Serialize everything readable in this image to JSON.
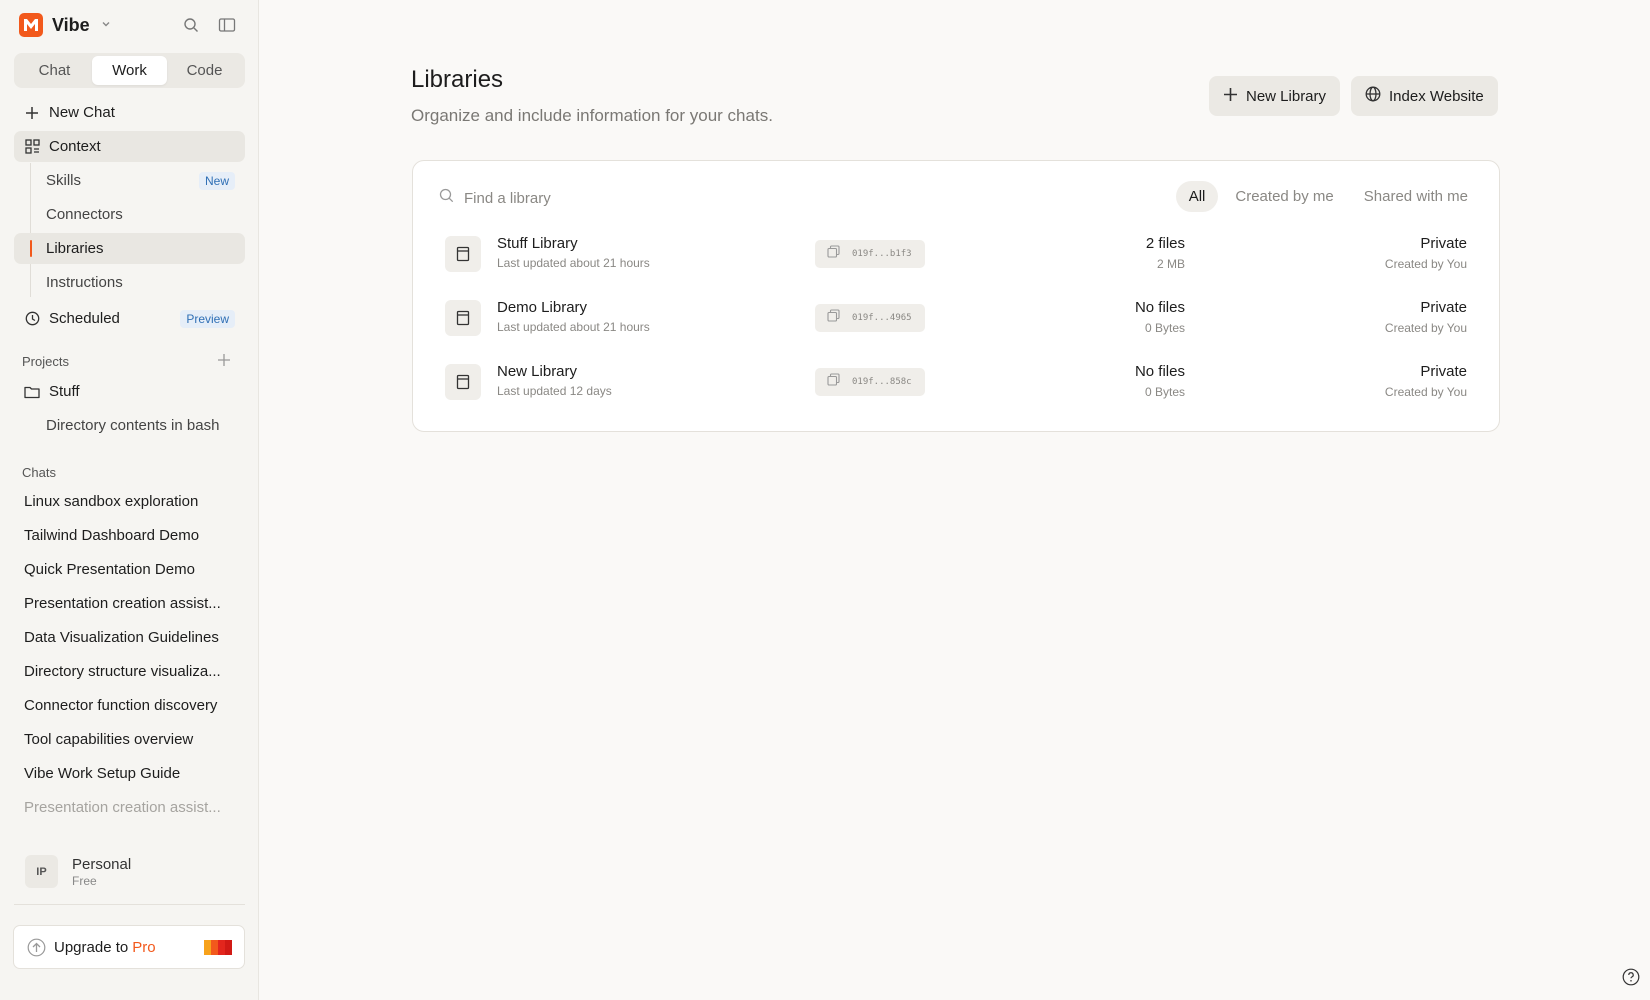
{
  "app": {
    "name": "Vibe"
  },
  "mode_tabs": [
    {
      "label": "Chat",
      "active": false
    },
    {
      "label": "Work",
      "active": true
    },
    {
      "label": "Code",
      "active": false
    }
  ],
  "nav": {
    "new_chat": "New Chat",
    "context": "Context",
    "context_items": [
      {
        "label": "Skills",
        "badge": "New"
      },
      {
        "label": "Connectors",
        "badge": ""
      },
      {
        "label": "Libraries",
        "badge": ""
      },
      {
        "label": "Instructions",
        "badge": ""
      }
    ],
    "scheduled": "Scheduled",
    "scheduled_badge": "Preview"
  },
  "projects": {
    "label": "Projects",
    "items": [
      {
        "name": "Stuff",
        "children": [
          "Directory contents in bash"
        ]
      }
    ]
  },
  "chats": {
    "label": "Chats",
    "items": [
      "Linux sandbox exploration",
      "Tailwind Dashboard Demo",
      "Quick Presentation Demo",
      "Presentation creation assist...",
      "Data Visualization Guidelines",
      "Directory structure visualiza...",
      "Connector function discovery",
      "Tool capabilities overview",
      "Vibe Work Setup Guide",
      "Presentation creation assist..."
    ]
  },
  "account": {
    "initials": "IP",
    "name": "Personal",
    "plan": "Free"
  },
  "upgrade": {
    "prefix": "Upgrade to",
    "highlight": "Pro"
  },
  "page": {
    "title": "Libraries",
    "subtitle": "Organize and include information for your chats.",
    "new_library_button": "New Library",
    "index_website_button": "Index Website"
  },
  "search": {
    "placeholder": "Find a library"
  },
  "filters": [
    {
      "label": "All",
      "active": true
    },
    {
      "label": "Created by me",
      "active": false
    },
    {
      "label": "Shared with me",
      "active": false
    }
  ],
  "libraries": [
    {
      "name": "Stuff Library",
      "updated": "Last updated about 21 hours",
      "id": "019f...b1f3",
      "files": "2 files",
      "size": "2 MB",
      "visibility": "Private",
      "created_by": "Created by You"
    },
    {
      "name": "Demo Library",
      "updated": "Last updated about 21 hours",
      "id": "019f...4965",
      "files": "No files",
      "size": "0 Bytes",
      "visibility": "Private",
      "created_by": "Created by You"
    },
    {
      "name": "New Library",
      "updated": "Last updated 12 days",
      "id": "019f...858c",
      "files": "No files",
      "size": "0 Bytes",
      "visibility": "Private",
      "created_by": "Created by You"
    }
  ],
  "colors": {
    "accent": "#f2591c",
    "badge_bg": "#e6eef8",
    "badge_text": "#2f6fb5"
  }
}
